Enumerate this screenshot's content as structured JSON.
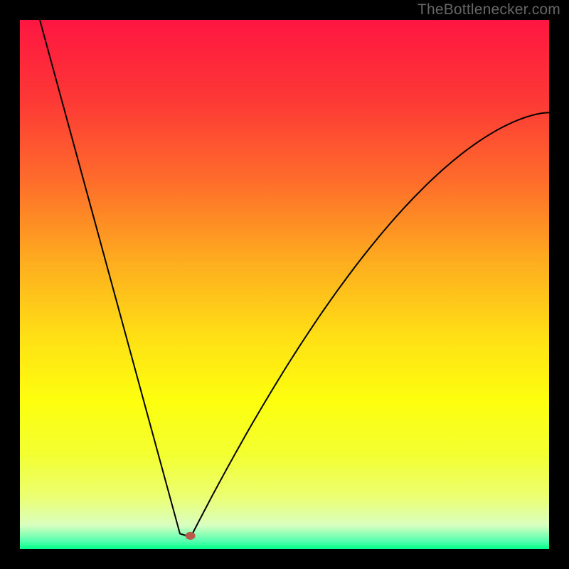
{
  "watermark": "TheBottlenecker.com",
  "chart_data": {
    "type": "line",
    "title": "",
    "xlabel": "",
    "ylabel": "",
    "xlim": [
      0,
      744
    ],
    "ylim": [
      0,
      744
    ],
    "curve": {
      "min_x": 235,
      "start": {
        "x": 28,
        "y_frac": 0.0
      },
      "left_end_at_min": {
        "approx_y_frac": 0.975
      },
      "right_asymptote_y_frac": 0.175
    },
    "marker": {
      "x_frac": 0.322,
      "y_frac": 0.975,
      "fill": "#b85a4a"
    },
    "gradient_stops": [
      {
        "offset": 0.0,
        "color": "#fe1641"
      },
      {
        "offset": 0.15,
        "color": "#fd3836"
      },
      {
        "offset": 0.3,
        "color": "#fe6b2b"
      },
      {
        "offset": 0.45,
        "color": "#feaa1f"
      },
      {
        "offset": 0.6,
        "color": "#ffe015"
      },
      {
        "offset": 0.72,
        "color": "#fdff0e"
      },
      {
        "offset": 0.82,
        "color": "#f3ff30"
      },
      {
        "offset": 0.9,
        "color": "#ecff70"
      },
      {
        "offset": 0.955,
        "color": "#d9ffc0"
      },
      {
        "offset": 0.985,
        "color": "#55ffaf"
      },
      {
        "offset": 1.0,
        "color": "#00ff88"
      }
    ]
  }
}
